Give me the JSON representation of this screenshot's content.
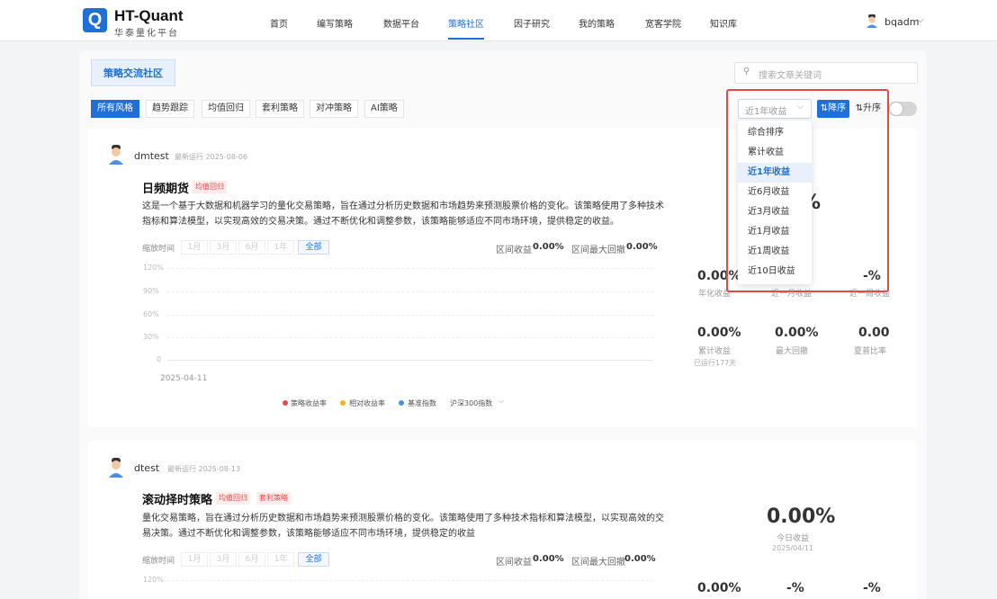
{
  "brand": {
    "logo_letter": "Q",
    "title": "HT-Quant",
    "subtitle": "华泰量化平台"
  },
  "nav": {
    "items": [
      "首页",
      "编写策略",
      "数据平台",
      "策略社区",
      "因子研究",
      "我的策略",
      "宽客学院",
      "知识库"
    ],
    "active": "策略社区"
  },
  "user": {
    "name": "bqadm",
    "caret": "⌵"
  },
  "community": {
    "title": "策略交流社区"
  },
  "search": {
    "placeholder": "搜索文章关键词",
    "icon": "search-icon"
  },
  "filters": [
    "所有风格",
    "趋势跟踪",
    "均值回归",
    "套利策略",
    "对冲策略",
    "AI策略"
  ],
  "sort": {
    "selected": "近1年收益",
    "caret": "⌵",
    "desc": "⇅降序",
    "asc": "⇅升序",
    "toggle_on": false,
    "options": [
      "综合排序",
      "累计收益",
      "近1年收益",
      "近6月收益",
      "近3月收益",
      "近1月收益",
      "近1周收益",
      "近10日收益"
    ]
  },
  "strategies": [
    {
      "user": "dmtest",
      "run_label": "最新运行 2025-08-06",
      "title": "日频期货",
      "tags": [
        "均值回归"
      ],
      "description": "这是一个基于大数据和机器学习的量化交易策略，旨在通过分析历史数据和市场趋势来预测股票价格的变化。该策略使用了多种技术指标和算法模型，以实现高效的交易决策。通过不断优化和调整参数，该策略能够适应不同市场环境，提供稳定的收益。",
      "desc_lines": [
        "这是一个基于大数据和机器学习的量化交易策略，旨在通过分析历史数据和市场趋势来预测股票价格的变化。该策略使用了多种技术",
        "指标和算法模型，以实现高效的交易决策。通过不断优化和调整参数，该策略能够适应不同市场环境，提供稳定的收益。"
      ],
      "range_label": "缩放时间",
      "ranges": [
        "1月",
        "3月",
        "6月",
        "1年",
        "全部"
      ],
      "range_active": "全部",
      "interval_return_label": "区间收益",
      "interval_return": "0.00%",
      "max_dd_label": "区间最大回撤",
      "max_dd": "0.00%",
      "yticks": [
        "120%",
        "90%",
        "60%",
        "30%",
        "0"
      ],
      "start_date": "2025-04-11",
      "legend": [
        {
          "label": "策略收益率",
          "color": "#e24a4a"
        },
        {
          "label": "相对收益率",
          "color": "#f5b31a"
        },
        {
          "label": "基准指数",
          "color": "#4a8fe7"
        }
      ],
      "benchmark": "沪深300指数",
      "benchmark_caret": "⌵",
      "partial_pct": "%",
      "metrics_row1": [
        {
          "value": "0.00%",
          "label": "年化收益"
        },
        {
          "value": "",
          "label": "近一月收益"
        },
        {
          "value": "-%",
          "label": "近一周收益"
        }
      ],
      "metrics_row2": [
        {
          "value": "0.00%",
          "label": "累计收益",
          "sub": "已运行177天"
        },
        {
          "value": "0.00%",
          "label": "最大回撤"
        },
        {
          "value": "0.00",
          "label": "夏普比率"
        }
      ]
    },
    {
      "user": "dtest",
      "run_label": "最新运行 2025-08-13",
      "title": "滚动择时策略",
      "tags": [
        "均值回归",
        "套利策略"
      ],
      "description": "量化交易策略，旨在通过分析历史数据和市场趋势来预测股票价格的变化。该策略使用了多种技术指标和算法模型，以实现高效的交易决策。通过不断优化和调整参数，该策略能够适应不同市场环境，提供稳定的收益",
      "desc_lines": [
        "量化交易策略，旨在通过分析历史数据和市场趋势来预测股票价格的变化。该策略使用了多种技术指标和算法模型，以实现高效的交",
        "易决策。通过不断优化和调整参数，该策略能够适应不同市场环境，提供稳定的收益"
      ],
      "range_label": "缩放时间",
      "ranges": [
        "1月",
        "3月",
        "6月",
        "1年",
        "全部"
      ],
      "range_active": "全部",
      "interval_return_label": "区间收益",
      "interval_return": "0.00%",
      "max_dd_label": "区间最大回撤",
      "max_dd": "0.00%",
      "ytick_top": "120%",
      "today_value": "0.00%",
      "today_label": "今日收益",
      "today_date": "2025/04/11",
      "metrics_row1": [
        {
          "value": "0.00%"
        },
        {
          "value": "-%"
        },
        {
          "value": "-%"
        }
      ]
    }
  ]
}
